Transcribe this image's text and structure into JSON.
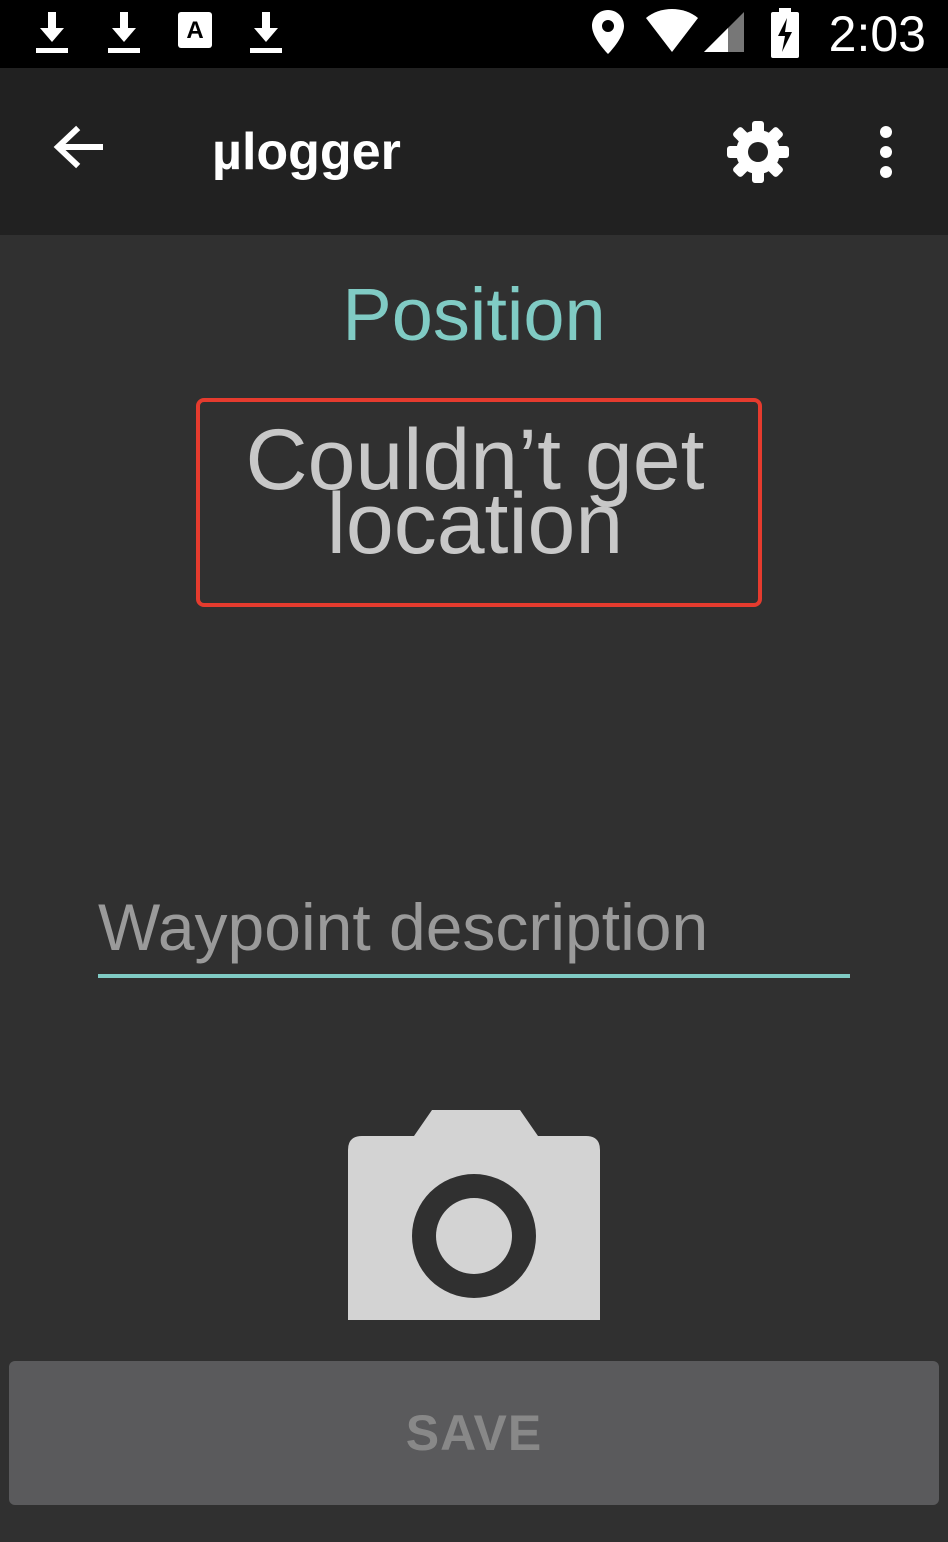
{
  "status_bar": {
    "time": "2:03",
    "left_icons": [
      "download-icon",
      "download-icon",
      "text-a-icon",
      "download-icon"
    ],
    "right_icons": [
      "location-pin-icon",
      "wifi-icon",
      "signal-icon",
      "battery-charging-icon"
    ]
  },
  "app_bar": {
    "title": "µlogger",
    "back_icon": "arrow-back-icon",
    "settings_icon": "gear-icon",
    "menu_icon": "more-vert-icon"
  },
  "main": {
    "heading": "Position",
    "location_status": "Couldn’t get location",
    "waypoint": {
      "value": "",
      "placeholder": "Waypoint description"
    },
    "camera_icon": "camera-icon",
    "save_label": "SAVE"
  },
  "colors": {
    "accent": "#80cbc4",
    "background": "#303030",
    "toolbar": "#212121",
    "highlight_border": "#e53b2e"
  }
}
